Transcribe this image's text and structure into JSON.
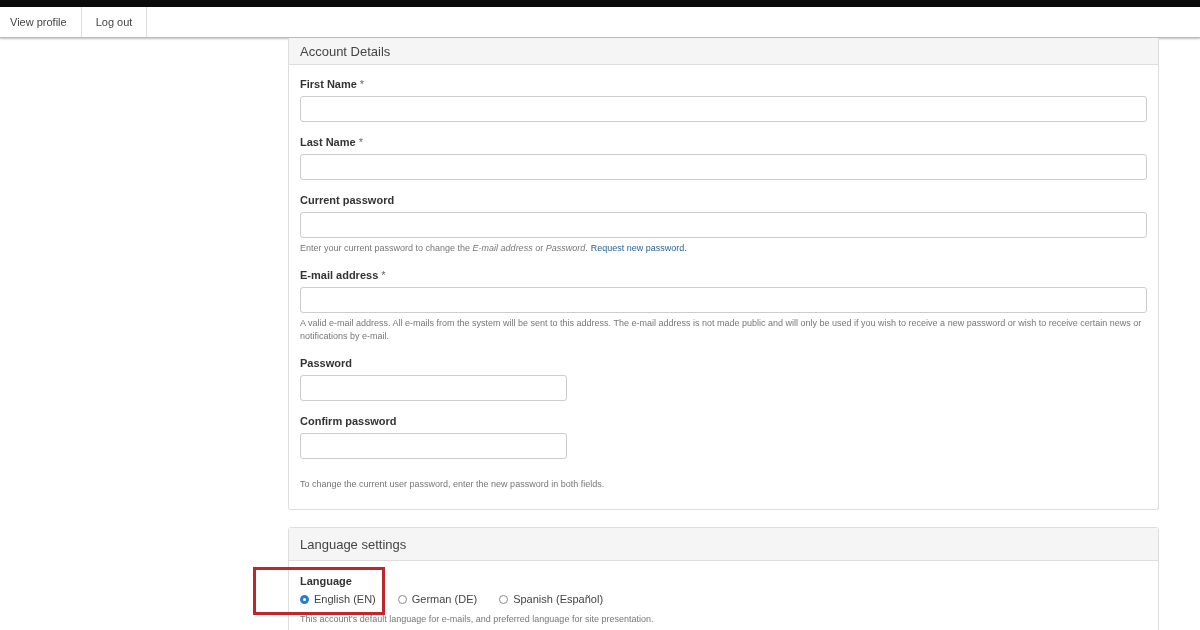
{
  "nav": {
    "tabs": [
      {
        "label": "View profile"
      },
      {
        "label": "Log out"
      }
    ]
  },
  "account_details": {
    "title": "Account Details",
    "fields": [
      {
        "label": "First Name",
        "required_mark": "*",
        "kind": "wide"
      },
      {
        "label": "Last Name",
        "required_mark": "*",
        "kind": "wide"
      },
      {
        "label": "Current password",
        "kind": "wide",
        "description": "Enter your current password to change the *E-mail address* or *Password*.",
        "link": "Request new password."
      },
      {
        "label": "E-mail address",
        "required_mark": "*",
        "kind": "wide",
        "description": "A valid e-mail address. All e-mails from the system will be sent to this address. The e-mail address is not made public and will only be used if you wish to receive a new password or wish to receive certain news or notifications by e-mail."
      },
      {
        "label": "Password",
        "kind": "short"
      },
      {
        "label": "Confirm password",
        "kind": "short"
      }
    ],
    "note": "To change the current user password, enter the new password in both fields."
  },
  "language_settings": {
    "title": "Language settings",
    "label": "Language",
    "highlighted": true,
    "options": [
      {
        "label": "English (EN)",
        "selected": true
      },
      {
        "label": "German (DE)",
        "selected": false
      },
      {
        "label": "Spanish (Español)",
        "selected": false
      }
    ],
    "description": "This account's default language for e-mails, and preferred language for site presentation."
  }
}
